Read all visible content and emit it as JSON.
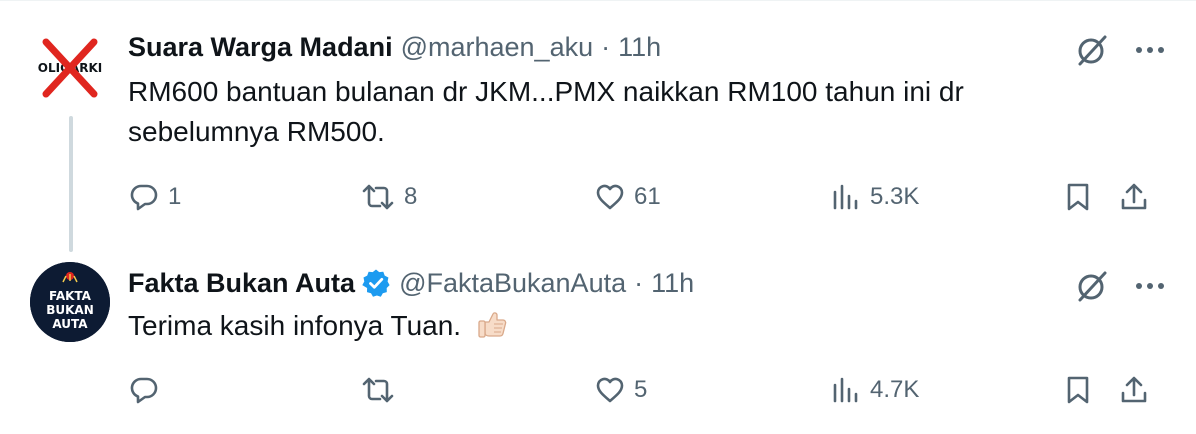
{
  "tweets": [
    {
      "author_name": "Suara Warga Madani",
      "handle": "@marhaen_aku",
      "separator": "·",
      "time": "11h",
      "verified": false,
      "avatar_text": "OLIGARKI",
      "text": "RM600 bantuan bulanan dr JKM...PMX naikkan RM100 tahun ini dr sebelumnya RM500.",
      "emoji": "",
      "counts": {
        "replies": "1",
        "retweets": "8",
        "likes": "61",
        "views": "5.3K"
      }
    },
    {
      "author_name": "Fakta Bukan Auta",
      "handle": "@FaktaBukanAuta",
      "separator": "·",
      "time": "11h",
      "verified": true,
      "avatar_text": [
        "FAKTA",
        "BUKAN",
        "AUTA"
      ],
      "text": "Terima kasih infonya Tuan.",
      "emoji": "thumbs-up-light-skin",
      "counts": {
        "replies": "",
        "retweets": "",
        "likes": "5",
        "views": "4.7K"
      }
    }
  ],
  "colors": {
    "text_primary": "#0f1419",
    "text_secondary": "#536471",
    "verified_blue": "#1d9bf0",
    "thread_line": "#cfd9de",
    "avatar2_bg": "#0d1b33",
    "cross_red": "#e0261f"
  },
  "icons": [
    "reply-icon",
    "retweet-icon",
    "like-icon",
    "views-icon",
    "bookmark-icon",
    "share-icon",
    "grok-icon",
    "more-icon",
    "verified-badge-icon"
  ]
}
